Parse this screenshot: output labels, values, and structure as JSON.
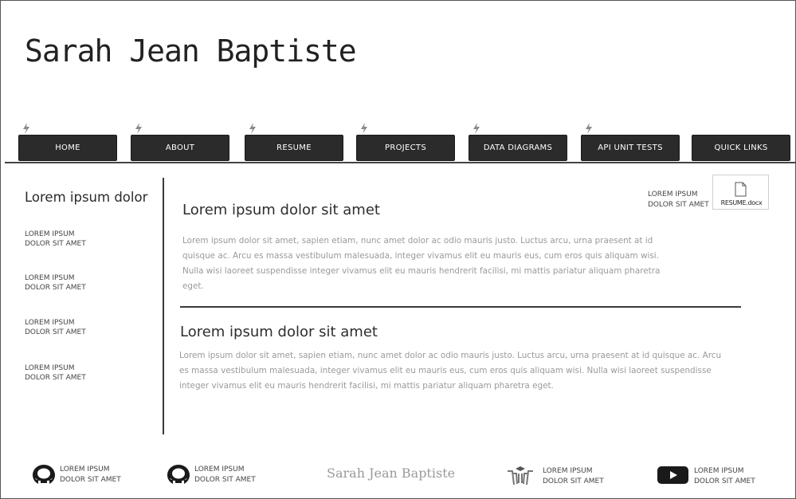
{
  "header": {
    "title": "Sarah Jean Baptiste"
  },
  "nav": {
    "items": [
      {
        "label": "HOME"
      },
      {
        "label": "ABOUT"
      },
      {
        "label": "RESUME"
      },
      {
        "label": "PROJECTS"
      },
      {
        "label": "DATA DIAGRAMS"
      },
      {
        "label": "API UNIT TESTS"
      },
      {
        "label": "QUICK LINKS"
      }
    ]
  },
  "sidebar": {
    "title": "Lorem ipsum dolor",
    "links": [
      {
        "line1": "LOREM IPSUM",
        "line2": "DOLOR SIT AMET"
      },
      {
        "line1": "LOREM IPSUM",
        "line2": "DOLOR SIT AMET"
      },
      {
        "line1": "LOREM IPSUM",
        "line2": "DOLOR SIT AMET"
      },
      {
        "line1": "LOREM IPSUM",
        "line2": "DOLOR SIT AMET"
      }
    ]
  },
  "main": {
    "section1": {
      "heading": "Lorem ipsum dolor sit amet",
      "lines": [
        "Lorem ipsum dolor sit amet, sapien etiam, nunc amet dolor ac odio mauris justo. Luctus arcu, urna praesent at id",
        "quisque ac. Arcu es massa vestibulum malesuada, integer vivamus elit eu mauris eus, cum eros quis aliquam wisi.",
        "Nulla wisi laoreet suspendisse integer vivamus elit eu mauris hendrerit facilisi, mi mattis pariatur aliquam pharetra",
        "eget."
      ]
    },
    "section2": {
      "heading": "Lorem ipsum dolor sit amet",
      "lines": [
        "Lorem ipsum dolor sit amet, sapien etiam, nunc amet dolor ac odio mauris justo. Luctus arcu, urna praesent at id quisque ac. Arcu",
        "es massa vestibulum malesuada, integer vivamus elit eu mauris eus, cum eros quis aliquam wisi. Nulla wisi laoreet suspendisse",
        "integer vivamus elit eu mauris hendrerit facilisi, mi mattis pariatur aliquam pharetra eget."
      ]
    }
  },
  "resume": {
    "label_line1": "LOREM IPSUM",
    "label_line2": "DOLOR SIT AMET",
    "file_name": "RESUME.docx",
    "icon": "document-icon"
  },
  "footer": {
    "name": "Sarah Jean Baptiste",
    "items": [
      {
        "icon": "github-icon",
        "line1": "LOREM IPSUM",
        "line2": "DOLOR SIT AMET"
      },
      {
        "icon": "github-icon",
        "line1": "LOREM IPSUM",
        "line2": "DOLOR SIT AMET"
      },
      {
        "icon": "stack-overflow-icon",
        "line1": "LOREM IPSUM",
        "line2": "DOLOR SIT AMET"
      },
      {
        "icon": "youtube-icon",
        "line1": "LOREM IPSUM",
        "line2": "DOLOR SIT AMET"
      }
    ]
  },
  "colors": {
    "nav_bg": "#2b2b2b",
    "rule": "#3a3a3a",
    "muted_text": "#9a9a9a"
  }
}
